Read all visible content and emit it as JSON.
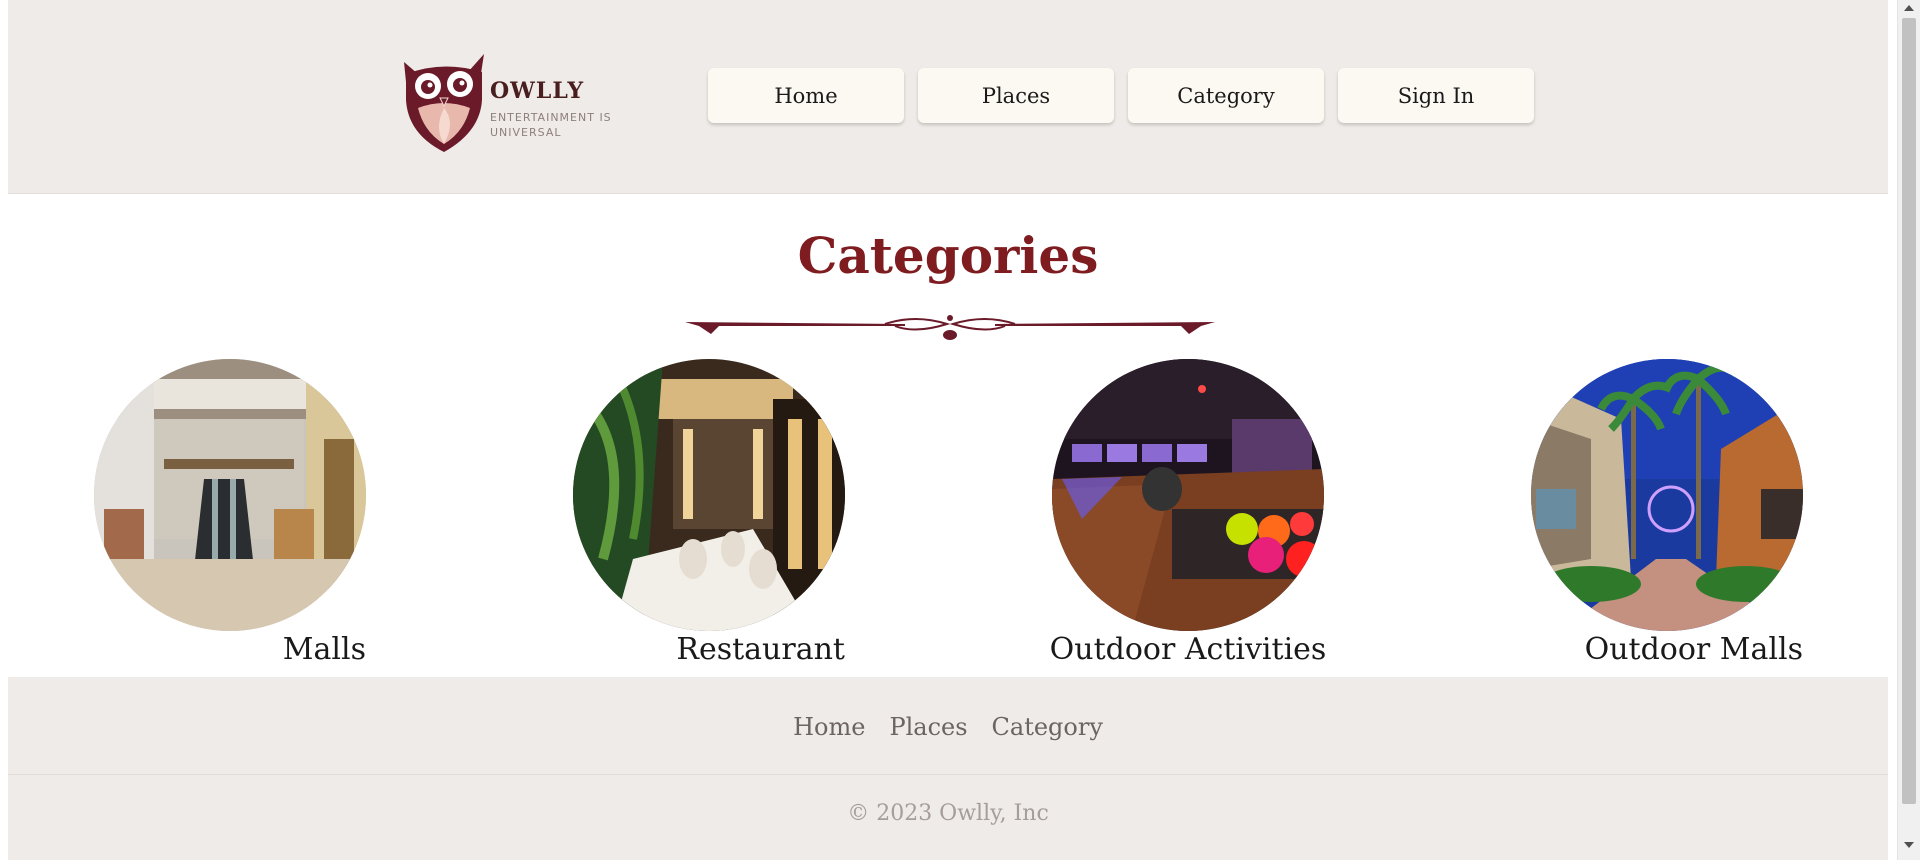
{
  "brand": {
    "name": "OWLLY",
    "tagline": "ENTERTAINMENT IS UNIVERSAL",
    "colors": {
      "primary": "#6b1a2a",
      "title": "#7e1c1f",
      "header_bg": "#efebe8",
      "button_bg": "#fcf8f2"
    }
  },
  "nav": {
    "items": [
      {
        "label": "Home"
      },
      {
        "label": "Places"
      },
      {
        "label": "Category"
      },
      {
        "label": "Sign In"
      }
    ]
  },
  "main": {
    "title": "Categories",
    "categories": [
      {
        "label": "Malls",
        "image": "mall-interior-escalator"
      },
      {
        "label": "Restaurant",
        "image": "restaurant-dining-room"
      },
      {
        "label": "Outdoor Activities",
        "image": "bowling-alley"
      },
      {
        "label": "Outdoor Malls",
        "image": "outdoor-mall-palm-trees"
      }
    ]
  },
  "footer": {
    "links": [
      {
        "label": "Home"
      },
      {
        "label": "Places"
      },
      {
        "label": "Category"
      }
    ],
    "copyright": "© 2023 Owlly, Inc"
  }
}
